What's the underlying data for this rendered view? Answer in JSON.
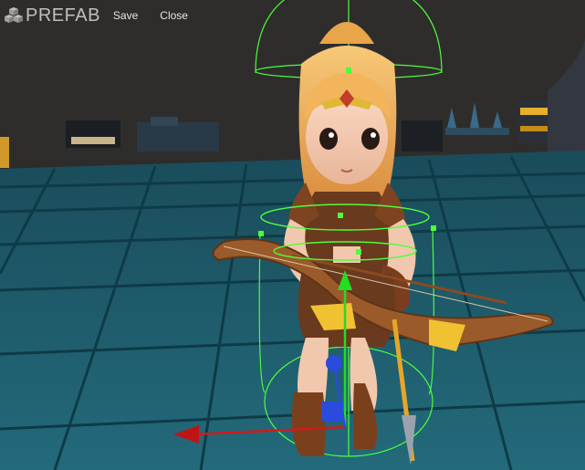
{
  "toolbar": {
    "logo_text": "PREFAB",
    "logo_icon": "cubes-icon",
    "save_label": "Save",
    "close_label": "Close"
  },
  "scene": {
    "description_icons": [
      "move-gizmo-x-arrow",
      "move-gizmo-y-arrow",
      "move-gizmo-z-handle",
      "capsule-collider",
      "bounding-box-handle"
    ],
    "colors": {
      "background": "#2e2c2a",
      "floor": "#1d5a6a",
      "floor_grid": "#0f3a45",
      "collider": "#4cff3c",
      "gizmo_x": "#d11a1a",
      "gizmo_y": "#22dd22",
      "gizmo_z": "#2a4bdc"
    }
  }
}
